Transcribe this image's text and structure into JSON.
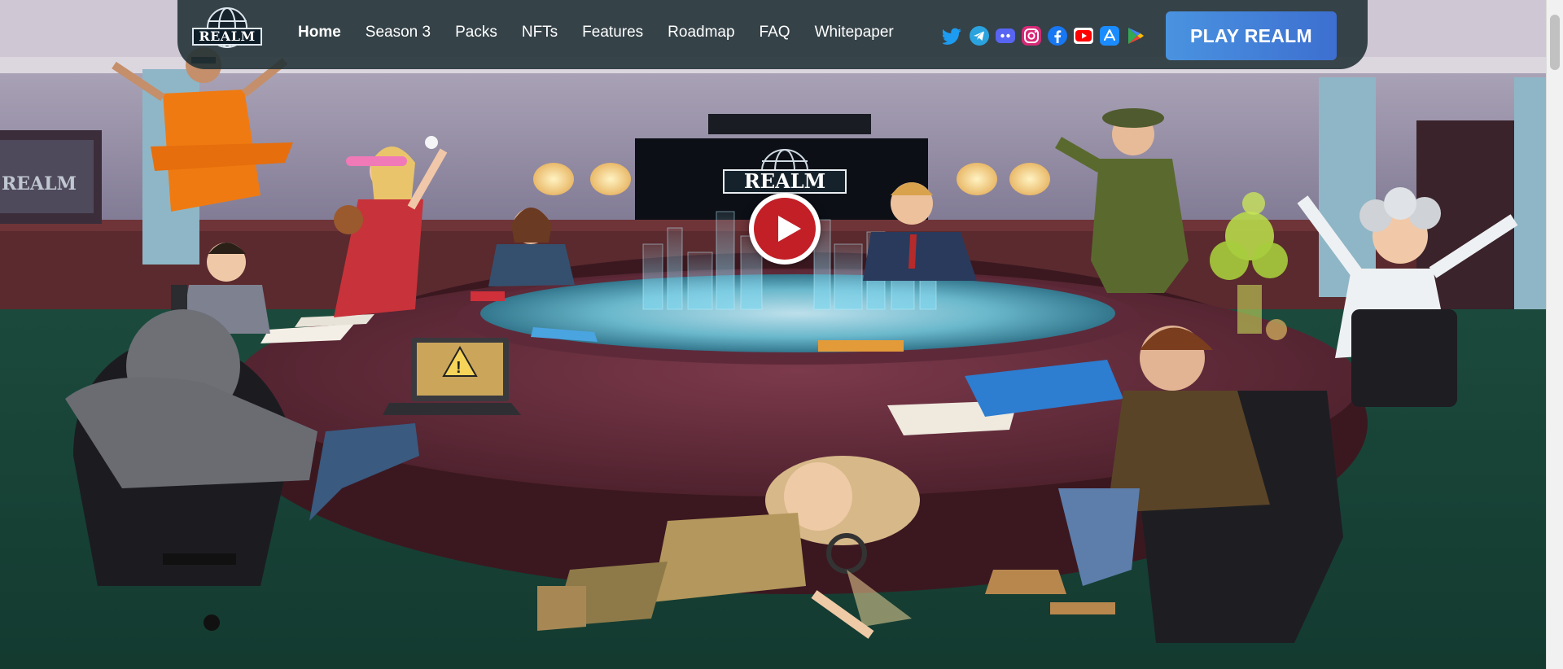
{
  "brand": {
    "logo_text": "REALM",
    "wall_logo_text": "REALM",
    "screen_logo_text": "REALM"
  },
  "nav": {
    "links": [
      {
        "label": "Home",
        "active": true
      },
      {
        "label": "Season 3",
        "active": false
      },
      {
        "label": "Packs",
        "active": false
      },
      {
        "label": "NFTs",
        "active": false
      },
      {
        "label": "Features",
        "active": false
      },
      {
        "label": "Roadmap",
        "active": false
      },
      {
        "label": "FAQ",
        "active": false
      },
      {
        "label": "Whitepaper",
        "active": false
      }
    ]
  },
  "social": [
    {
      "icon": "twitter-icon",
      "color": "#1d9bf0"
    },
    {
      "icon": "telegram-icon",
      "color": "#2aa3df"
    },
    {
      "icon": "discord-icon",
      "color": "#5865f2"
    },
    {
      "icon": "instagram-icon",
      "color": "#d62976"
    },
    {
      "icon": "facebook-icon",
      "color": "#1877f2"
    },
    {
      "icon": "youtube-icon",
      "color": "#ff0000"
    },
    {
      "icon": "app-store-icon",
      "color": "#1a8cff"
    },
    {
      "icon": "google-play-icon",
      "color": "#34a853"
    }
  ],
  "cta": {
    "play_label": "PLAY REALM",
    "color": "#4a93e0"
  },
  "video": {
    "play_icon": "play-icon",
    "color": "#c21f26"
  },
  "colors": {
    "navbar": "#203034",
    "floor": "#1f4a3c",
    "table": "#5a2430",
    "wall": "#8f8a9e"
  }
}
